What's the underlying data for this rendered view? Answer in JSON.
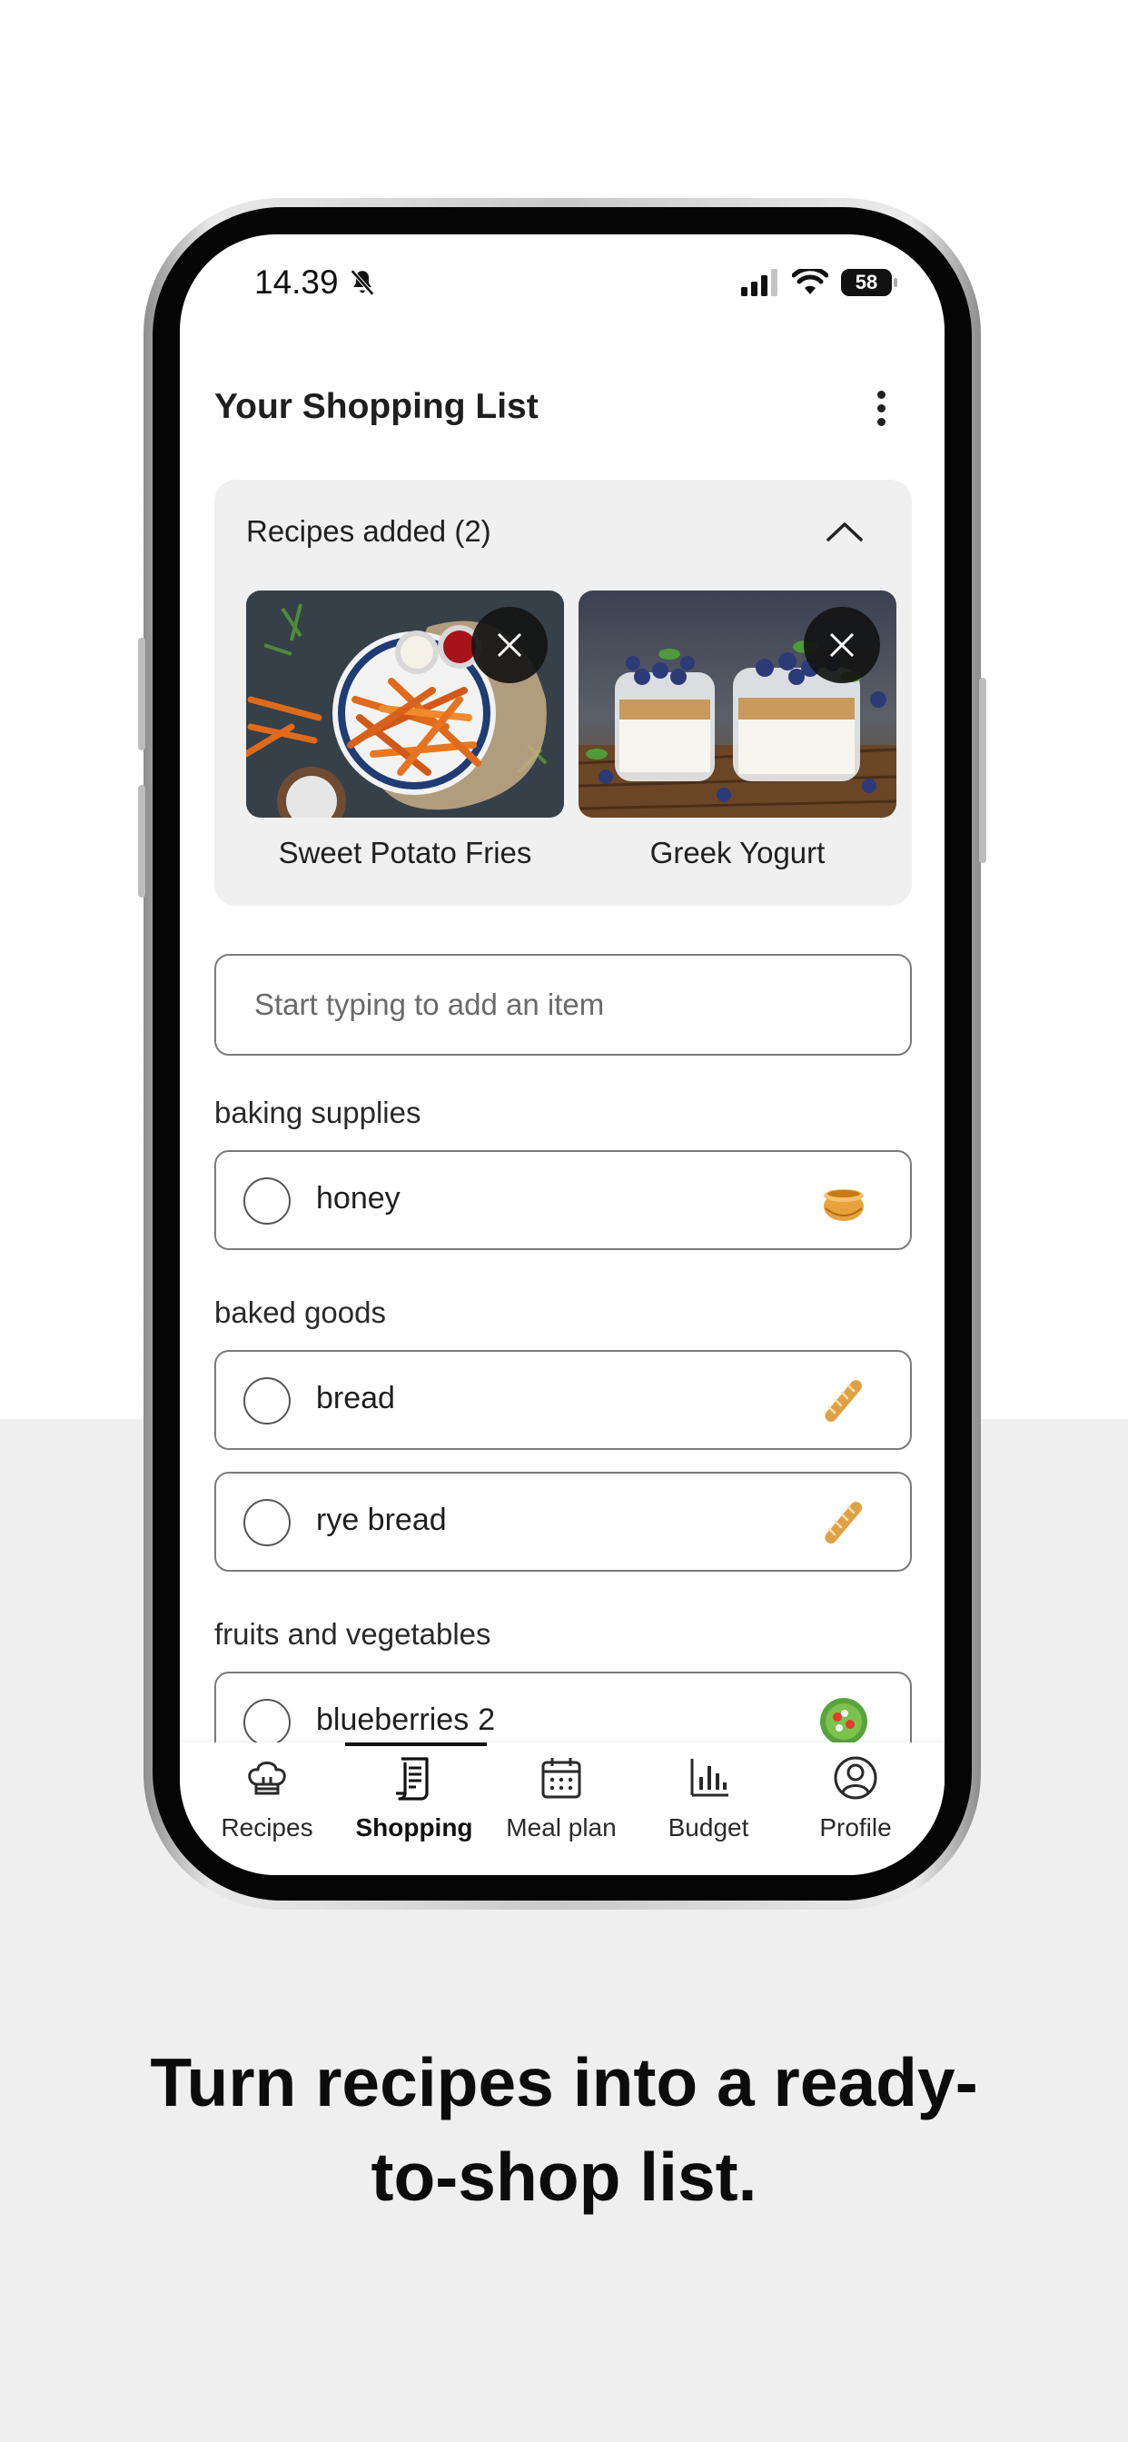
{
  "status_bar": {
    "time": "14.39",
    "battery": "58"
  },
  "header": {
    "title": "Your Shopping List"
  },
  "recipes_panel": {
    "heading": "Recipes added (2)",
    "recipes": [
      {
        "name": "Sweet Potato Fries"
      },
      {
        "name": "Greek Yogurt"
      }
    ]
  },
  "add_item": {
    "placeholder": "Start typing to add an item"
  },
  "sections": [
    {
      "label": "baking supplies",
      "items": [
        {
          "name": "honey",
          "qty": "",
          "icon": "honey-pot-icon"
        }
      ]
    },
    {
      "label": "baked goods",
      "items": [
        {
          "name": "bread",
          "qty": "",
          "icon": "baguette-icon"
        },
        {
          "name": "rye bread",
          "qty": "",
          "icon": "baguette-icon"
        }
      ]
    },
    {
      "label": "fruits and vegetables",
      "items": [
        {
          "name": "blueberries",
          "qty": "2",
          "icon": "salad-icon"
        }
      ]
    }
  ],
  "tabbar": {
    "tabs": [
      {
        "label": "Recipes",
        "icon": "chef-hat-icon"
      },
      {
        "label": "Shopping",
        "icon": "receipt-icon",
        "active": true
      },
      {
        "label": "Meal plan",
        "icon": "calendar-icon"
      },
      {
        "label": "Budget",
        "icon": "bar-chart-icon"
      },
      {
        "label": "Profile",
        "icon": "user-circle-icon"
      }
    ]
  },
  "headline": {
    "line1": "Turn recipes into a ready-",
    "line2": "to-shop list."
  },
  "colors": {
    "panel_bg": "#f0f0f0",
    "lower_bg": "#efefef",
    "border": "#7b7b7b",
    "text": "#1f1f1f"
  }
}
